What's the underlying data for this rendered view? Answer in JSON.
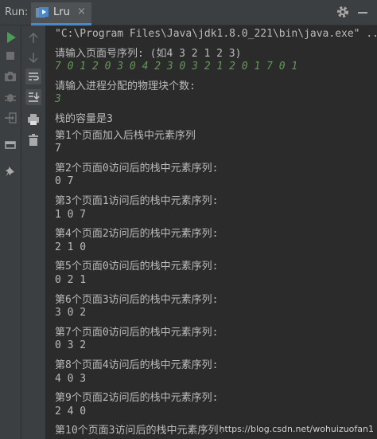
{
  "header": {
    "run_label": "Run:",
    "tab_label": "Lru",
    "tab_close": "×"
  },
  "toolbar": {
    "buttons": [
      "run-icon",
      "stop-icon",
      "camera-icon",
      "bug-icon",
      "login-icon",
      "layout-icon",
      "pin-icon",
      "up-arrow-icon",
      "down-arrow-icon",
      "soft-wrap-icon",
      "scroll-to-end-icon",
      "print-icon",
      "trash-icon"
    ]
  },
  "console": {
    "lines": [
      {
        "text": "\"C:\\Program Files\\Java\\jdk1.8.0_221\\bin\\java.exe\" ...",
        "kind": "cmd"
      },
      {
        "text": "请输入页面号序列: (如4 3 2 1 2 3)",
        "kind": "out"
      },
      {
        "text": "7 0 1 2 0 3 0 4 2 3 0 3 2 1 2 0 1 7 0 1",
        "kind": "input"
      },
      {
        "text": "请输入进程分配的物理块个数:",
        "kind": "out"
      },
      {
        "text": "3",
        "kind": "input"
      },
      {
        "text": "栈的容量是3",
        "kind": "out"
      },
      {
        "text": "第1个页面加入后栈中元素序列",
        "kind": "out"
      },
      {
        "text": "7",
        "kind": "out"
      },
      {
        "text": "第2个页面0访问后的栈中元素序列:",
        "kind": "out"
      },
      {
        "text": "0 7",
        "kind": "out"
      },
      {
        "text": "第3个页面1访问后的栈中元素序列:",
        "kind": "out"
      },
      {
        "text": "1 0 7",
        "kind": "out"
      },
      {
        "text": "第4个页面2访问后的栈中元素序列:",
        "kind": "out"
      },
      {
        "text": "2 1 0",
        "kind": "out"
      },
      {
        "text": "第5个页面0访问后的栈中元素序列:",
        "kind": "out"
      },
      {
        "text": "0 2 1",
        "kind": "out"
      },
      {
        "text": "第6个页面3访问后的栈中元素序列:",
        "kind": "out"
      },
      {
        "text": "3 0 2",
        "kind": "out"
      },
      {
        "text": "第7个页面0访问后的栈中元素序列:",
        "kind": "out"
      },
      {
        "text": "0 3 2",
        "kind": "out"
      },
      {
        "text": "第8个页面4访问后的栈中元素序列:",
        "kind": "out"
      },
      {
        "text": "4 0 3",
        "kind": "out"
      },
      {
        "text": "第9个页面2访问后的栈中元素序列:",
        "kind": "out"
      },
      {
        "text": "2 4 0",
        "kind": "out"
      },
      {
        "text": "第10个页面3访问后的栈中元素序列:",
        "kind": "out"
      }
    ]
  },
  "watermark": "https://blog.csdn.net/wohuizuofan1",
  "colors": {
    "background": "#2b2b2b",
    "panel": "#3c3f41",
    "text": "#bbbbbb",
    "user_input": "#629755",
    "run_green": "#499c54",
    "tab_underline": "#4a88c7"
  }
}
